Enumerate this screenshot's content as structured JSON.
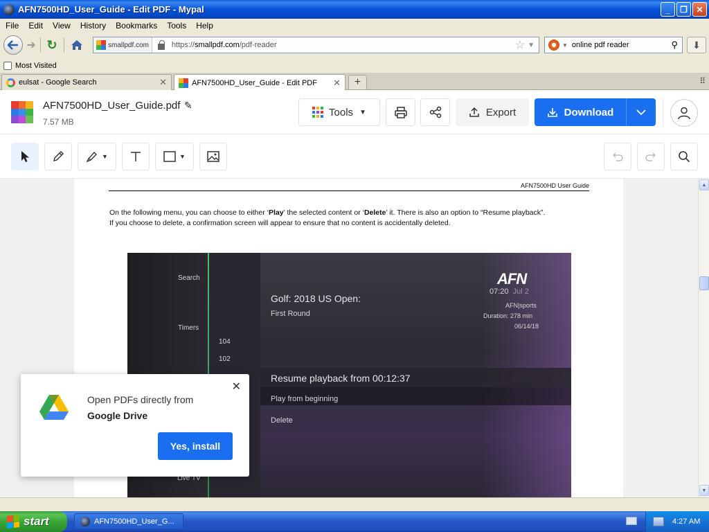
{
  "window": {
    "title": "AFN7500HD_User_Guide - Edit PDF - Mypal",
    "btn_min": "_",
    "btn_max": "❐",
    "btn_close": "✕"
  },
  "menu": [
    "File",
    "Edit",
    "View",
    "History",
    "Bookmarks",
    "Tools",
    "Help"
  ],
  "nav": {
    "site_identity": "smallpdf.com",
    "url_prefix": "https://",
    "url_host": "smallpdf.com",
    "url_path": "/pdf-reader",
    "search_query": "online pdf reader"
  },
  "bookmarks": {
    "most_visited": "Most Visited"
  },
  "tabs": [
    {
      "label": "eulsat - Google Search",
      "active": false
    },
    {
      "label": "AFN7500HD_User_Guide - Edit PDF",
      "active": true
    }
  ],
  "app": {
    "filename": "AFN7500HD_User_Guide.pdf",
    "filesize": "7.57 MB",
    "tools_label": "Tools",
    "export_label": "Export",
    "download_label": "Download",
    "brand_colors": {
      "primary_blue": "#1a6ff0",
      "logo": [
        "#e93a2f",
        "#f26b2a",
        "#f5b31e",
        "#2b7be4",
        "#3a8dea",
        "#3bb54a",
        "#8e4bd8",
        "#c24bd8",
        "#6dc056"
      ]
    }
  },
  "document": {
    "header_text": "AFN7500HD User Guide",
    "para_1": "On the following menu, you can choose to either ‘",
    "para_play": "Play",
    "para_2": "’ the selected content or ‘",
    "para_delete": "Delete",
    "para_3": "’ it. There is also an option to “Resume playback”.",
    "para_line2": "If you choose to delete, a confirmation screen will appear to ensure that no content is accidentally deleted.",
    "tv": {
      "menu_search": "Search",
      "menu_timers": "Timers",
      "menu_livetv": "Live TV",
      "ch_104": "104",
      "ch_102": "102",
      "program_title": "Golf: 2018 US Open:",
      "program_sub": "First Round",
      "brand": "AFN",
      "time": "07:20",
      "date": "Jul 2",
      "channel_name": "AFN|sports",
      "duration": "Duration: 278 min",
      "air_date": "06/14/18",
      "opt_resume": "Resume playback from 00:12:37",
      "opt_begin": "Play from beginning",
      "opt_delete": "Delete"
    }
  },
  "popup": {
    "line1": "Open PDFs directly from",
    "line2": "Google Drive",
    "button": "Yes, install"
  },
  "taskbar": {
    "start": "start",
    "task": "AFN7500HD_User_G...",
    "clock": "4:27 AM"
  }
}
